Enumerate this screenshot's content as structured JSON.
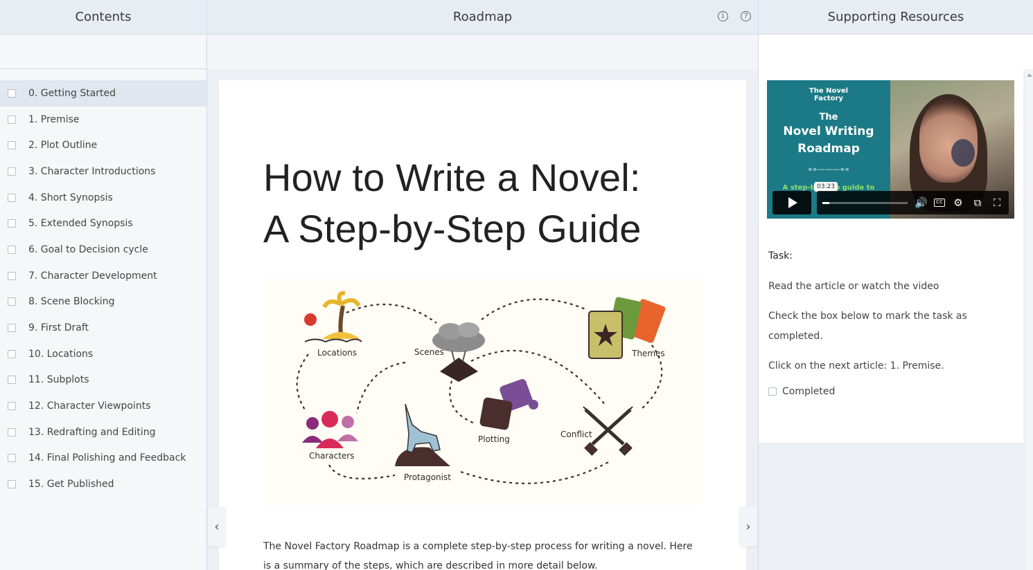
{
  "headers": {
    "contents": "Contents",
    "roadmap": "Roadmap",
    "resources": "Supporting Resources"
  },
  "header_icons": [
    "info-icon",
    "help-icon"
  ],
  "toc": {
    "items": [
      {
        "label": "0. Getting Started",
        "active": true
      },
      {
        "label": "1. Premise"
      },
      {
        "label": "2. Plot Outline"
      },
      {
        "label": "3. Character Introductions"
      },
      {
        "label": "4. Short Synopsis"
      },
      {
        "label": "5. Extended Synopsis"
      },
      {
        "label": "6. Goal to Decision cycle"
      },
      {
        "label": "7. Character Development"
      },
      {
        "label": "8. Scene Blocking"
      },
      {
        "label": "9. First Draft"
      },
      {
        "label": "10. Locations"
      },
      {
        "label": "11. Subplots"
      },
      {
        "label": "12. Character Viewpoints"
      },
      {
        "label": "13. Redrafting and Editing"
      },
      {
        "label": "14. Final Polishing and Feedback"
      },
      {
        "label": "15. Get Published"
      }
    ]
  },
  "article": {
    "title_line1": "How to Write a Novel:",
    "title_line2": "A Step-by-Step Guide",
    "intro": "The Novel Factory Roadmap is a complete step-by-step process for writing a novel. Here is a summary of the steps, which are described in more detail below.",
    "infographic_labels": {
      "locations": "Locations",
      "scenes": "Scenes",
      "themes": "Themes",
      "characters": "Characters",
      "protagonist": "Protagonist",
      "plotting": "Plotting",
      "conflict": "Conflict"
    }
  },
  "video": {
    "brand_line1": "The Novel",
    "brand_line2": "Factory",
    "the": "The",
    "title_line1": "Novel Writing",
    "title_line2": "Roadmap",
    "arrows": "»»———««",
    "tagline": "A step-by-step guide to",
    "timestamp": "03:23",
    "progress": 0.08,
    "controls": [
      "volume-icon",
      "captions-icon",
      "settings-icon",
      "pip-icon",
      "fullscreen-icon"
    ]
  },
  "task": {
    "label": "Task:",
    "line1": "Read the article or watch the video",
    "line2": "Check the box below to mark the task as completed.",
    "line3": "Click on the next article: 1. Premise.",
    "completed_label": "Completed"
  },
  "colors": {
    "header_bg": "#e8edf3",
    "video_teal": "#1c7a86",
    "active_item": "#e1e7ef"
  }
}
